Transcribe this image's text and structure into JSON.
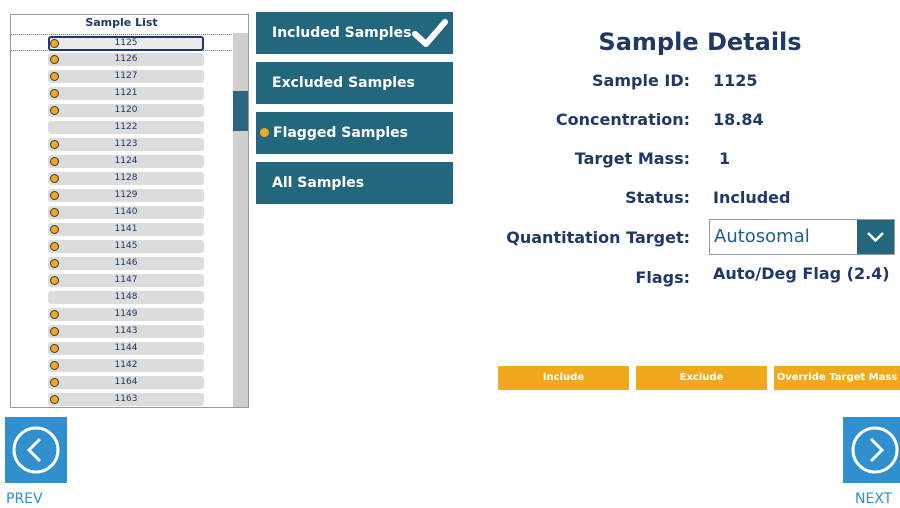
{
  "sample_list": {
    "header": "Sample List",
    "rows": [
      {
        "id": "1125",
        "flagged": true,
        "selected": true
      },
      {
        "id": "1126",
        "flagged": true,
        "selected": false
      },
      {
        "id": "1127",
        "flagged": true,
        "selected": false
      },
      {
        "id": "1121",
        "flagged": true,
        "selected": false
      },
      {
        "id": "1120",
        "flagged": true,
        "selected": false
      },
      {
        "id": "1122",
        "flagged": false,
        "selected": false
      },
      {
        "id": "1123",
        "flagged": true,
        "selected": false
      },
      {
        "id": "1124",
        "flagged": true,
        "selected": false
      },
      {
        "id": "1128",
        "flagged": true,
        "selected": false
      },
      {
        "id": "1129",
        "flagged": true,
        "selected": false
      },
      {
        "id": "1140",
        "flagged": true,
        "selected": false
      },
      {
        "id": "1141",
        "flagged": true,
        "selected": false
      },
      {
        "id": "1145",
        "flagged": true,
        "selected": false
      },
      {
        "id": "1146",
        "flagged": true,
        "selected": false
      },
      {
        "id": "1147",
        "flagged": true,
        "selected": false
      },
      {
        "id": "1148",
        "flagged": false,
        "selected": false
      },
      {
        "id": "1149",
        "flagged": true,
        "selected": false
      },
      {
        "id": "1143",
        "flagged": true,
        "selected": false
      },
      {
        "id": "1144",
        "flagged": true,
        "selected": false
      },
      {
        "id": "1142",
        "flagged": true,
        "selected": false
      },
      {
        "id": "1164",
        "flagged": true,
        "selected": false
      },
      {
        "id": "1163",
        "flagged": true,
        "selected": false
      }
    ]
  },
  "filters": {
    "included_label": "Included Samples",
    "excluded_label": "Excluded Samples",
    "flagged_label": "Flagged Samples",
    "all_label": "All Samples"
  },
  "details": {
    "title": "Sample Details",
    "sample_id_label": "Sample ID:",
    "sample_id": "1125",
    "concentration_label": "Concentration:",
    "concentration": "18.84",
    "target_mass_label": "Target Mass:",
    "target_mass": "1",
    "status_label": "Status:",
    "status": "Included",
    "quant_target_label": "Quantitation Target:",
    "quant_target": "Autosomal",
    "flags_label": "Flags:",
    "flags": "Auto/Deg Flag (2.4)"
  },
  "actions": {
    "include_label": "Include",
    "exclude_label": "Exclude",
    "override_label": "Override Target Mass"
  },
  "nav": {
    "prev_label": "PREV",
    "next_label": "NEXT"
  },
  "colors": {
    "primary": "#23677f",
    "accent": "#f0a81c",
    "nav": "#2f8fcf",
    "text": "#1f3864"
  }
}
